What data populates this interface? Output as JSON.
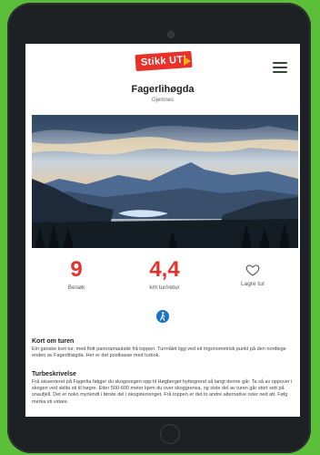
{
  "brand": {
    "logo_text": "Stikk UT!",
    "accent": "#e8312b"
  },
  "header": {
    "title": "Fagerlihøgda",
    "subtitle": "Gjemnes"
  },
  "stats": [
    {
      "value": "9",
      "label": "Besøk"
    },
    {
      "value": "4,4",
      "label": "km tur/retur"
    },
    {
      "value": "",
      "label": "Lagre tur"
    }
  ],
  "sections": {
    "short": {
      "heading": "Kort om turen",
      "text": "Ein ganske kort tur, med flott panoramautsikt frå toppen. Turmålet ligg ved eit trigonometrisk punkt på den nordlege enden av Fagerlihøgda. Her er det postkasse med turbok."
    },
    "desc": {
      "heading": "Turbeskrivelse",
      "text": "Frå skisenteret på Fagerlia følgjer du skogsvegen opp til Høgberget hyttegrend så langt denne går. Ta så av oppover i skogen ved skilta sti til høgre. Etter 500-600 meter kjem du over skoggrensa, og siste del av turen går stort sett på snaufjell. Det er noko myrlendt i første del i skogsterrenget. Frå toppen er det to andre alternative ruter ned att. Følg merka sti vidare."
    }
  }
}
